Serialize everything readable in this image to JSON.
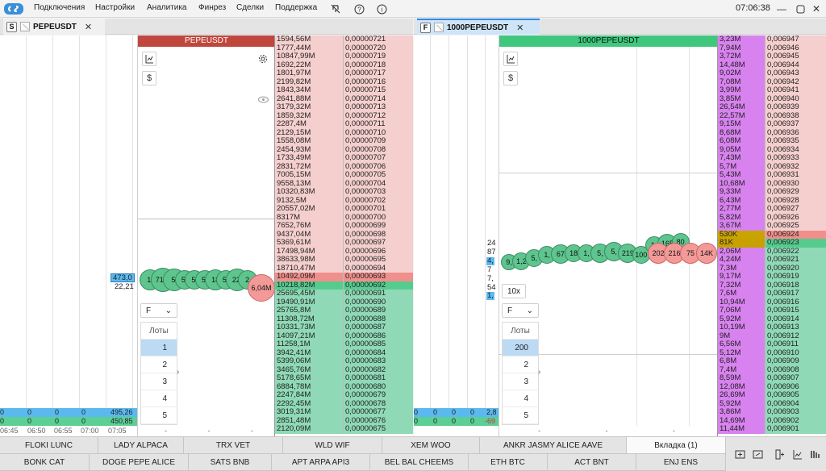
{
  "menu": [
    "Подключения",
    "Настройки",
    "Аналитика",
    "Финрез",
    "Сделки",
    "Поддержка"
  ],
  "icons": {
    "mute": "mute-icon",
    "help": "help-icon",
    "info": "info-icon"
  },
  "clock": "07:06:38",
  "left_panel": {
    "badge": "S",
    "tab_title": "PEPEUSDT",
    "chart_title": "PEPEUSDT",
    "header_color": "#c0473e",
    "price_label": "473,0",
    "price_sub": "22,21",
    "bubbles_buy": [
      "1,",
      "71,8",
      "5,",
      "5,",
      "5,",
      "5,",
      "18",
      "5,",
      "22,",
      "2"
    ],
    "bubble_sell": "6,04M",
    "select": "F",
    "lots_title": "Лоты",
    "lots": [
      "1",
      "2",
      "3",
      "4",
      "5"
    ],
    "times": [
      "06:45",
      "06:50",
      "06:55",
      "07:00",
      "07:05"
    ],
    "blue_row": [
      "0",
      "0",
      "0",
      "0",
      "495,26"
    ],
    "green_row": [
      "0",
      "0",
      "0",
      "0",
      "450,85"
    ],
    "dash": "-",
    "book": [
      [
        "1594,56M",
        "0,00000721",
        "ask"
      ],
      [
        "1777,44M",
        "0,00000720",
        "ask"
      ],
      [
        "10847,99M",
        "0,00000719",
        "ask"
      ],
      [
        "1692,22M",
        "0,00000718",
        "ask"
      ],
      [
        "1801,97M",
        "0,00000717",
        "ask"
      ],
      [
        "2199,82M",
        "0,00000716",
        "ask"
      ],
      [
        "1843,34M",
        "0,00000715",
        "ask"
      ],
      [
        "2641,88M",
        "0,00000714",
        "ask"
      ],
      [
        "3179,32M",
        "0,00000713",
        "ask"
      ],
      [
        "1859,32M",
        "0,00000712",
        "ask"
      ],
      [
        "2287,4M",
        "0,00000711",
        "ask"
      ],
      [
        "2129,15M",
        "0,00000710",
        "ask"
      ],
      [
        "1558,08M",
        "0,00000709",
        "ask"
      ],
      [
        "2454,93M",
        "0,00000708",
        "ask"
      ],
      [
        "1733,49M",
        "0,00000707",
        "ask"
      ],
      [
        "2831,72M",
        "0,00000706",
        "ask"
      ],
      [
        "7005,15M",
        "0,00000705",
        "ask"
      ],
      [
        "9558,13M",
        "0,00000704",
        "ask"
      ],
      [
        "10320,83M",
        "0,00000703",
        "ask"
      ],
      [
        "9132,5M",
        "0,00000702",
        "ask"
      ],
      [
        "20557,02M",
        "0,00000701",
        "ask"
      ],
      [
        "8317M",
        "0,00000700",
        "ask"
      ],
      [
        "7652,76M",
        "0,00000699",
        "ask"
      ],
      [
        "9437,04M",
        "0,00000698",
        "ask"
      ],
      [
        "5369,61M",
        "0,00000697",
        "ask"
      ],
      [
        "17498,94M",
        "0,00000696",
        "ask"
      ],
      [
        "38633,98M",
        "0,00000695",
        "ask"
      ],
      [
        "18710,47M",
        "0,00000694",
        "ask"
      ],
      [
        "10492,09M",
        "0,00000693",
        "best_ask"
      ],
      [
        "10218,82M",
        "0,00000692",
        "best_bid"
      ],
      [
        "25695,45M",
        "0,00000691",
        "bid"
      ],
      [
        "19490,91M",
        "0,00000690",
        "bid"
      ],
      [
        "25765,8M",
        "0,00000689",
        "bid"
      ],
      [
        "11308,72M",
        "0,00000688",
        "bid"
      ],
      [
        "10331,73M",
        "0,00000687",
        "bid"
      ],
      [
        "14097,21M",
        "0,00000686",
        "bid"
      ],
      [
        "11258,1M",
        "0,00000685",
        "bid"
      ],
      [
        "3942,41M",
        "0,00000684",
        "bid"
      ],
      [
        "5399,06M",
        "0,00000683",
        "bid"
      ],
      [
        "3465,76M",
        "0,00000682",
        "bid"
      ],
      [
        "5178,65M",
        "0,00000681",
        "bid"
      ],
      [
        "6884,78M",
        "0,00000680",
        "bid"
      ],
      [
        "2247,84M",
        "0,00000679",
        "bid"
      ],
      [
        "2292,45M",
        "0,00000678",
        "bid"
      ],
      [
        "3019,31M",
        "0,00000677",
        "bid"
      ],
      [
        "2851,48M",
        "0,00000676",
        "bid"
      ],
      [
        "2120,09M",
        "0,00000675",
        "bid"
      ]
    ]
  },
  "right_panel": {
    "badge": "F",
    "tab_title": "1000PEPEUSDT",
    "chart_title": "1000PEPEUSDT",
    "header_color": "#3fc77e",
    "side_values": [
      "24",
      "87",
      "4,",
      "7",
      "7,",
      "54",
      "1,"
    ],
    "bubbles_buy": [
      "9,",
      "1,2",
      "5,",
      "1,",
      "67",
      "18",
      "1,",
      "5,",
      "5,",
      "219",
      "100",
      "1,",
      "165",
      "80"
    ],
    "bubbles_sell": [
      "202",
      "216",
      "75",
      "14K"
    ],
    "leverage": "10x",
    "select": "F",
    "lots_title": "Лоты",
    "lots": [
      "200",
      "2",
      "3",
      "4",
      "5"
    ],
    "blue_row": [
      "0",
      "0",
      "0",
      "0",
      "2,8"
    ],
    "green_row": [
      "0",
      "0",
      "0",
      "0",
      "-69"
    ],
    "dash": "-",
    "book": [
      [
        "3,23M",
        "0,006947",
        "ask"
      ],
      [
        "7,94M",
        "0,006946",
        "ask"
      ],
      [
        "3,72M",
        "0,006945",
        "ask"
      ],
      [
        "14,48M",
        "0,006944",
        "ask"
      ],
      [
        "9,02M",
        "0,006943",
        "ask"
      ],
      [
        "7,08M",
        "0,006942",
        "ask"
      ],
      [
        "3,99M",
        "0,006941",
        "ask"
      ],
      [
        "3,85M",
        "0,006940",
        "ask"
      ],
      [
        "26,54M",
        "0,006939",
        "ask"
      ],
      [
        "22,57M",
        "0,006938",
        "ask"
      ],
      [
        "9,15M",
        "0,006937",
        "ask"
      ],
      [
        "8,68M",
        "0,006936",
        "ask"
      ],
      [
        "6,08M",
        "0,006935",
        "ask"
      ],
      [
        "9,05M",
        "0,006934",
        "ask"
      ],
      [
        "7,43M",
        "0,006933",
        "ask"
      ],
      [
        "5,7M",
        "0,006932",
        "ask"
      ],
      [
        "5,43M",
        "0,006931",
        "ask"
      ],
      [
        "10,68M",
        "0,006930",
        "ask"
      ],
      [
        "9,33M",
        "0,006929",
        "ask"
      ],
      [
        "6,43M",
        "0,006928",
        "ask"
      ],
      [
        "2,77M",
        "0,006927",
        "ask"
      ],
      [
        "5,82M",
        "0,006926",
        "ask"
      ],
      [
        "3,67M",
        "0,006925",
        "ask"
      ],
      [
        "530K",
        "0,006924",
        "best_ask"
      ],
      [
        "81K",
        "0,006923",
        "best_bid"
      ],
      [
        "2,06M",
        "0,006922",
        "bid"
      ],
      [
        "4,24M",
        "0,006921",
        "bid"
      ],
      [
        "7,3M",
        "0,006920",
        "bid"
      ],
      [
        "9,17M",
        "0,006919",
        "bid"
      ],
      [
        "7,32M",
        "0,006918",
        "bid"
      ],
      [
        "7,6M",
        "0,006917",
        "bid"
      ],
      [
        "10,94M",
        "0,006916",
        "bid"
      ],
      [
        "7,06M",
        "0,006915",
        "bid"
      ],
      [
        "5,92M",
        "0,006914",
        "bid"
      ],
      [
        "10,19M",
        "0,006913",
        "bid"
      ],
      [
        "9M",
        "0,006912",
        "bid"
      ],
      [
        "6,56M",
        "0,006911",
        "bid"
      ],
      [
        "5,12M",
        "0,006910",
        "bid"
      ],
      [
        "6,8M",
        "0,006909",
        "bid"
      ],
      [
        "7,4M",
        "0,006908",
        "bid"
      ],
      [
        "8,59M",
        "0,006907",
        "bid"
      ],
      [
        "12,08M",
        "0,006906",
        "bid"
      ],
      [
        "26,69M",
        "0,006905",
        "bid"
      ],
      [
        "5,92M",
        "0,006904",
        "bid"
      ],
      [
        "3,86M",
        "0,006903",
        "bid"
      ],
      [
        "14,69M",
        "0,006902",
        "bid"
      ],
      [
        "11,44M",
        "0,006901",
        "bid"
      ]
    ]
  },
  "bottom_tabs_row1": [
    "FLOKI LUNC",
    "LADY ALPACA",
    "TRX VET",
    "WLD WIF",
    "XEM WOO",
    "ANKR JASMY ALICE AAVE",
    "Вкладка (1)"
  ],
  "bottom_tabs_row2": [
    "BONK CAT",
    "DOGE PEPE ALICE",
    "SATS BNB",
    "APT ARPA API3",
    "BEL BAL CHEEMS",
    "ETH BTC",
    "ACT BNT",
    "ENJ ENS"
  ],
  "bottom_icons": [
    "add-panel-icon",
    "link-icon",
    "add-column-icon",
    "chart-add-icon",
    "columns-icon"
  ],
  "colors": {
    "ask": "#f4cfcd",
    "bid": "#8fd9b6",
    "best_ask": "#f08f8c",
    "best_bid": "#55cc8e",
    "volume_right": "#d882ef",
    "volume_ask_hl": "#c9a400",
    "volume_bid_hl": "#c8a100",
    "blue_row": "#5cb9ef",
    "green_row": "#5ccf95"
  }
}
